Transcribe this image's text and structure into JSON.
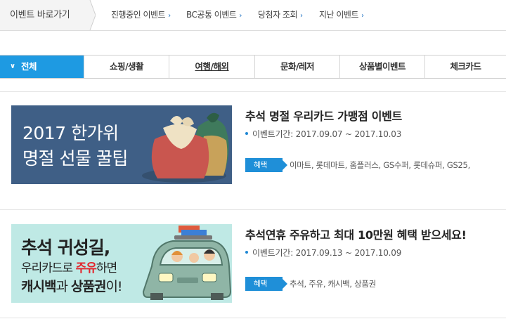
{
  "topbar": {
    "title": "이벤트 바로가기",
    "links": [
      {
        "label": "진행중인 이벤트",
        "chev": "›"
      },
      {
        "label": "BC공통 이벤트",
        "chev": "›"
      },
      {
        "label": "당첨자 조회",
        "chev": "›"
      },
      {
        "label": "지난 이벤트",
        "chev": "›"
      }
    ]
  },
  "tabs": [
    {
      "label": "전체",
      "chev": "∨"
    },
    {
      "label": "쇼핑/생활"
    },
    {
      "label": "여행/해외"
    },
    {
      "label": "문화/레저"
    },
    {
      "label": "상품별이벤트"
    },
    {
      "label": "체크카드"
    }
  ],
  "events": [
    {
      "title": "추석 명절 우리카드 가맹점 이벤트",
      "period": "이벤트기간: 2017.09.07 ~ 2017.10.03",
      "badge": "혜택",
      "benefit": "이마트, 롯데마트, 홈플러스, GS수퍼, 롯데슈퍼, GS25,",
      "banner": {
        "line1": "2017 한가위",
        "line2": "명절 선물 꿀팁",
        "bg_color": "#3f5f86"
      }
    },
    {
      "title": "추석연휴 주유하고 최대 10만원 혜택 받으세요!",
      "period": "이벤트기간: 2017.09.13 ~ 2017.10.09",
      "badge": "혜택",
      "benefit": "추석, 주유, 캐시백, 상품권",
      "banner": {
        "line1": "추석 귀성길,",
        "line2a": "우리카드로 ",
        "line2b": "주유",
        "line2c": "하면",
        "line3a": "캐시백",
        "line3b": "과 ",
        "line3c": "상품권",
        "line3d": "이!",
        "bg_color": "#bfe9e5"
      }
    }
  ],
  "colors": {
    "accent": "#1e9ae2",
    "badge": "#1f8fd8",
    "highlight_red": "#e3242b"
  }
}
